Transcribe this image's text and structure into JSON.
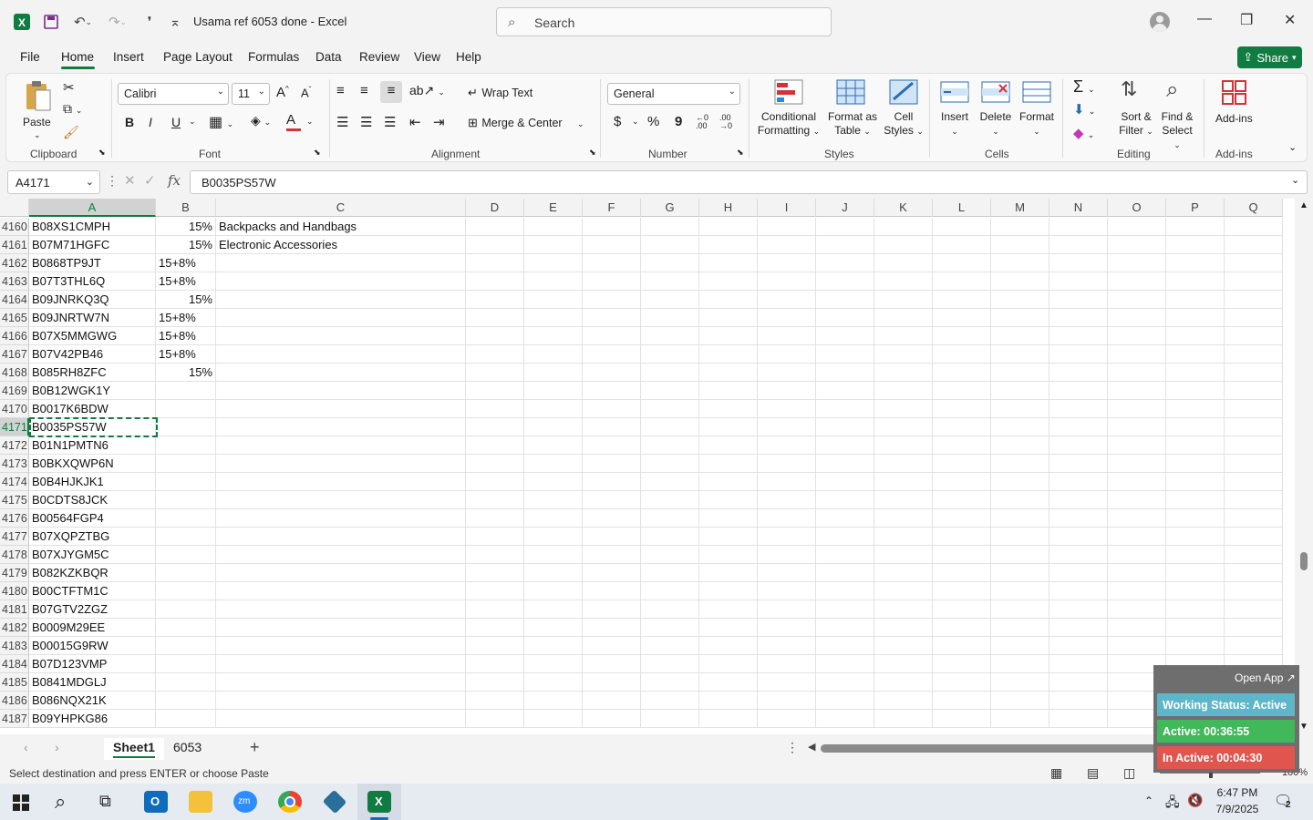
{
  "titlebar": {
    "title": "Usama ref 6053 done  -  Excel",
    "search_placeholder": "Search",
    "icons": [
      "excel-icon",
      "save-icon",
      "undo-icon",
      "redo-icon",
      "touch-icon",
      "customize-icon"
    ]
  },
  "menu": [
    "File",
    "Home",
    "Insert",
    "Page Layout",
    "Formulas",
    "Data",
    "Review",
    "View",
    "Help"
  ],
  "share_label": "Share",
  "ribbon": {
    "clipboard": {
      "label": "Clipboard",
      "paste": "Paste"
    },
    "font": {
      "label": "Font",
      "name": "Calibri",
      "size": "11",
      "bold": "B",
      "italic": "I",
      "underline": "U"
    },
    "alignment": {
      "label": "Alignment",
      "wrap": "Wrap Text",
      "merge": "Merge & Center"
    },
    "number": {
      "label": "Number",
      "format": "General",
      "currency": "$",
      "percent": "%",
      "comma": "9",
      "inc": "←0 .00",
      "dec": ".00 →0"
    },
    "styles": {
      "label": "Styles",
      "conditional": "Conditional",
      "conditional2": "Formatting",
      "format_table": "Format as",
      "format_table2": "Table",
      "cell_styles": "Cell",
      "cell_styles2": "Styles"
    },
    "cells": {
      "label": "Cells",
      "insert": "Insert",
      "delete": "Delete",
      "format": "Format"
    },
    "editing": {
      "label": "Editing",
      "sort": "Sort &",
      "sort2": "Filter",
      "find": "Find &",
      "find2": "Select"
    },
    "addins": {
      "label": "Add-ins",
      "addins": "Add-ins"
    }
  },
  "formula_bar": {
    "name_box": "A4171",
    "fx": "fx",
    "content": "B0035PS57W"
  },
  "columns": [
    "A",
    "B",
    "C",
    "D",
    "E",
    "F",
    "G",
    "H",
    "I",
    "J",
    "K",
    "L",
    "M",
    "N",
    "O",
    "P",
    "Q"
  ],
  "rows": [
    {
      "n": "4160",
      "a": "B08XS1CMPH",
      "b": "15%",
      "b_align": "r",
      "c": "Backpacks and Handbags"
    },
    {
      "n": "4161",
      "a": "B07M71HGFC",
      "b": "15%",
      "b_align": "r",
      "c": "Electronic Accessories"
    },
    {
      "n": "4162",
      "a": "B0868TP9JT",
      "b": "15+8%",
      "b_align": "l",
      "c": ""
    },
    {
      "n": "4163",
      "a": "B07T3THL6Q",
      "b": "15+8%",
      "b_align": "l",
      "c": ""
    },
    {
      "n": "4164",
      "a": "B09JNRKQ3Q",
      "b": "15%",
      "b_align": "r",
      "c": ""
    },
    {
      "n": "4165",
      "a": "B09JNRTW7N",
      "b": "15+8%",
      "b_align": "l",
      "c": ""
    },
    {
      "n": "4166",
      "a": "B07X5MMGWG",
      "b": "15+8%",
      "b_align": "l",
      "c": ""
    },
    {
      "n": "4167",
      "a": "B07V42PB46",
      "b": "15+8%",
      "b_align": "l",
      "c": ""
    },
    {
      "n": "4168",
      "a": "B085RH8ZFC",
      "b": "15%",
      "b_align": "r",
      "c": ""
    },
    {
      "n": "4169",
      "a": "B0B12WGK1Y",
      "b": "",
      "b_align": "l",
      "c": ""
    },
    {
      "n": "4170",
      "a": "B0017K6BDW",
      "b": "",
      "b_align": "l",
      "c": ""
    },
    {
      "n": "4171",
      "a": "B0035PS57W",
      "b": "",
      "b_align": "l",
      "c": ""
    },
    {
      "n": "4172",
      "a": "B01N1PMTN6",
      "b": "",
      "b_align": "l",
      "c": ""
    },
    {
      "n": "4173",
      "a": "B0BKXQWP6N",
      "b": "",
      "b_align": "l",
      "c": ""
    },
    {
      "n": "4174",
      "a": "B0B4HJKJK1",
      "b": "",
      "b_align": "l",
      "c": ""
    },
    {
      "n": "4175",
      "a": "B0CDTS8JCK",
      "b": "",
      "b_align": "l",
      "c": ""
    },
    {
      "n": "4176",
      "a": "B00564FGP4",
      "b": "",
      "b_align": "l",
      "c": ""
    },
    {
      "n": "4177",
      "a": "B07XQPZTBG",
      "b": "",
      "b_align": "l",
      "c": ""
    },
    {
      "n": "4178",
      "a": "B07XJYGM5C",
      "b": "",
      "b_align": "l",
      "c": ""
    },
    {
      "n": "4179",
      "a": "B082KZKBQR",
      "b": "",
      "b_align": "l",
      "c": ""
    },
    {
      "n": "4180",
      "a": "B00CTFTM1C",
      "b": "",
      "b_align": "l",
      "c": ""
    },
    {
      "n": "4181",
      "a": "B07GTV2ZGZ",
      "b": "",
      "b_align": "l",
      "c": ""
    },
    {
      "n": "4182",
      "a": "B0009M29EE",
      "b": "",
      "b_align": "l",
      "c": ""
    },
    {
      "n": "4183",
      "a": "B00015G9RW",
      "b": "",
      "b_align": "l",
      "c": ""
    },
    {
      "n": "4184",
      "a": "B07D123VMP",
      "b": "",
      "b_align": "l",
      "c": ""
    },
    {
      "n": "4185",
      "a": "B0841MDGLJ",
      "b": "",
      "b_align": "l",
      "c": ""
    },
    {
      "n": "4186",
      "a": "B086NQX21K",
      "b": "",
      "b_align": "l",
      "c": ""
    },
    {
      "n": "4187",
      "a": "B09YHPKG86",
      "b": "",
      "b_align": "l",
      "c": ""
    }
  ],
  "sheets": [
    "Sheet1",
    "6053"
  ],
  "status": {
    "message": "Select destination and press ENTER or choose Paste",
    "zoom": "100%"
  },
  "overlay": {
    "open_app": "Open App ↗",
    "working": "Working Status: Active",
    "active": "Active: 00:36:55",
    "inactive": "In Active: 00:04:30"
  },
  "taskbar": {
    "time": "6:47 PM",
    "date": "7/9/2025",
    "notif_count": "2"
  },
  "colors": {
    "excel_green": "#107c41",
    "selection": "#107c41",
    "overlay_blue": "#5fb6c8",
    "overlay_green": "#41b85a",
    "overlay_red": "#e0564e"
  }
}
